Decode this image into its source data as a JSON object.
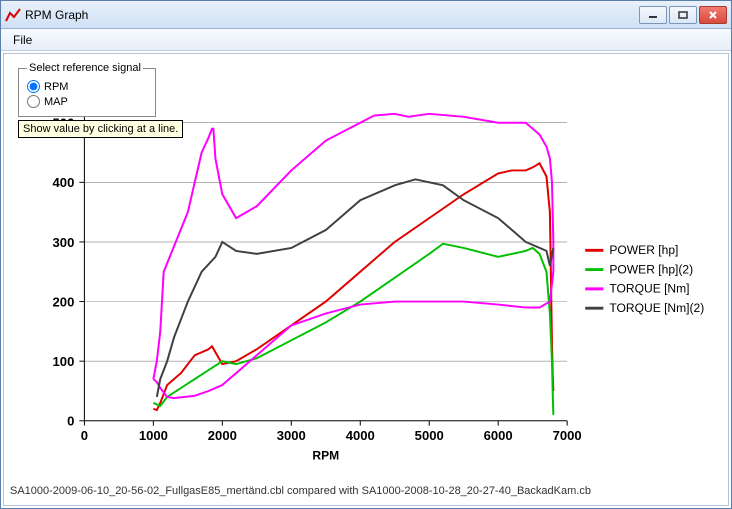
{
  "window": {
    "title": "RPM Graph",
    "menu": {
      "file": "File"
    }
  },
  "ref_panel": {
    "legend": "Select reference signal",
    "rpm": "RPM",
    "map": "MAP",
    "selected": "rpm"
  },
  "tooltip": "Show value by clicking at a line.",
  "statusbar": "SA1000-2009-06-10_20-56-02_FullgasE85_mertänd.cbl  compared with  SA1000-2008-10-28_20-27-40_BackadKam.cb",
  "chart_data": {
    "type": "line",
    "xlabel": "RPM",
    "ylabel": "",
    "xlim": [
      0,
      7000
    ],
    "ylim": [
      0,
      550
    ],
    "xticks": [
      0,
      1000,
      2000,
      3000,
      4000,
      5000,
      6000,
      7000
    ],
    "yticks": [
      0,
      100,
      200,
      300,
      400,
      500
    ],
    "series": [
      {
        "name": "POWER [hp]",
        "color": "#e00000",
        "x": [
          1000,
          1050,
          1100,
          1200,
          1400,
          1600,
          1800,
          1850,
          1900,
          2000,
          2200,
          2500,
          3000,
          3500,
          4000,
          4500,
          5000,
          5500,
          6000,
          6200,
          6400,
          6500,
          6600,
          6700,
          6750,
          6760,
          6770,
          6780,
          6790,
          6800
        ],
        "y": [
          20,
          18,
          30,
          60,
          80,
          110,
          120,
          125,
          115,
          95,
          100,
          120,
          160,
          200,
          250,
          300,
          340,
          380,
          415,
          420,
          420,
          425,
          432,
          410,
          350,
          280,
          200,
          130,
          80,
          50
        ]
      },
      {
        "name": "POWER [hp](2)",
        "color": "#00c000",
        "x": [
          1000,
          1100,
          1200,
          1400,
          1600,
          1800,
          2000,
          2200,
          2500,
          3000,
          3500,
          4000,
          4500,
          5000,
          5200,
          5500,
          6000,
          6400,
          6500,
          6600,
          6700,
          6750,
          6780,
          6790,
          6800
        ],
        "y": [
          30,
          25,
          40,
          55,
          70,
          85,
          100,
          95,
          105,
          135,
          165,
          200,
          240,
          280,
          297,
          290,
          275,
          285,
          290,
          280,
          250,
          180,
          100,
          50,
          10
        ]
      },
      {
        "name": "TORQUE [Nm]",
        "color": "#ff00ff",
        "x": [
          1000,
          1050,
          1100,
          1150,
          1500,
          1600,
          1700,
          1800,
          1850,
          1870,
          1900,
          2000,
          2200,
          2500,
          3000,
          3500,
          4000,
          4200,
          4500,
          4700,
          5000,
          5500,
          6000,
          6400,
          6500,
          6600,
          6700,
          6750,
          6780,
          6800,
          6800,
          6750,
          6600,
          6400,
          6000,
          5500,
          5000,
          4500,
          4000,
          3500,
          3000,
          2500,
          2200,
          2000,
          1800,
          1600,
          1300,
          1200,
          1100,
          1050,
          1000
        ],
        "y": [
          70,
          100,
          150,
          250,
          350,
          400,
          450,
          475,
          490,
          490,
          440,
          380,
          340,
          360,
          420,
          470,
          500,
          512,
          515,
          510,
          515,
          510,
          500,
          500,
          490,
          480,
          460,
          440,
          400,
          300,
          250,
          200,
          190,
          190,
          195,
          200,
          200,
          200,
          195,
          180,
          160,
          110,
          80,
          60,
          50,
          42,
          38,
          40,
          55,
          65,
          70
        ]
      },
      {
        "name": "TORQUE [Nm](2)",
        "color": "#404040",
        "x": [
          1050,
          1100,
          1200,
          1300,
          1500,
          1700,
          1900,
          2000,
          2200,
          2500,
          3000,
          3500,
          4000,
          4500,
          4800,
          5000,
          5200,
          5500,
          6000,
          6400,
          6600,
          6700,
          6750,
          6800
        ],
        "y": [
          40,
          70,
          100,
          140,
          200,
          250,
          275,
          300,
          285,
          280,
          290,
          320,
          370,
          395,
          405,
          400,
          395,
          370,
          340,
          300,
          290,
          285,
          260,
          290
        ]
      }
    ],
    "legend": {
      "entries": [
        "POWER [hp]",
        "POWER [hp](2)",
        "TORQUE [Nm]",
        "TORQUE [Nm](2)"
      ]
    }
  }
}
